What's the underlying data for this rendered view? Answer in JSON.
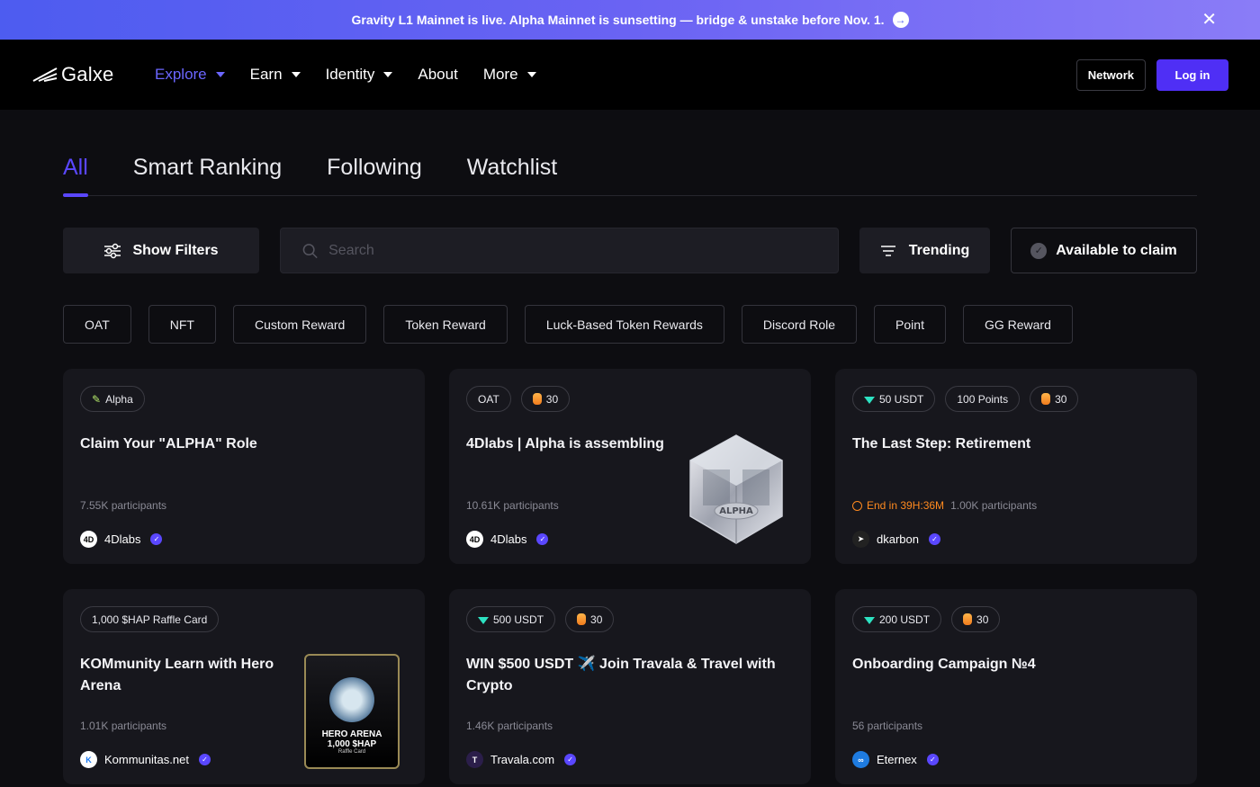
{
  "banner": {
    "text": "Gravity L1 Mainnet is live. Alpha Mainnet is sunsetting — bridge & unstake before Nov. 1.",
    "arrow": "→",
    "close": "✕"
  },
  "nav": {
    "logo": "Galxe",
    "items": [
      {
        "label": "Explore",
        "dropdown": true,
        "active": true
      },
      {
        "label": "Earn",
        "dropdown": true
      },
      {
        "label": "Identity",
        "dropdown": true
      },
      {
        "label": "About",
        "dropdown": false
      },
      {
        "label": "More",
        "dropdown": true
      }
    ],
    "network_label": "Network",
    "login_label": "Log in"
  },
  "tabs": [
    "All",
    "Smart Ranking",
    "Following",
    "Watchlist"
  ],
  "filters": {
    "show_filters": "Show Filters",
    "search_placeholder": "Search",
    "sort": "Trending",
    "claim": "Available to claim"
  },
  "chips": [
    "OAT",
    "NFT",
    "Custom Reward",
    "Token Reward",
    "Luck-Based Token Rewards",
    "Discord Role",
    "Point",
    "GG Reward"
  ],
  "cards": [
    {
      "badges": [
        {
          "icon": "pencil",
          "label": "Alpha"
        }
      ],
      "title": "Claim Your \"ALPHA\" Role",
      "participants": "7.55K participants",
      "owner": "4Dlabs",
      "owner_logo": "4D"
    },
    {
      "badges": [
        {
          "icon": "",
          "label": "OAT"
        },
        {
          "icon": "coin",
          "label": "30"
        }
      ],
      "title": "4Dlabs | Alpha is assembling",
      "participants": "10.61K participants",
      "owner": "4Dlabs",
      "owner_logo": "4D",
      "art": "ALPHA"
    },
    {
      "badges": [
        {
          "icon": "gem",
          "label": "50 USDT"
        },
        {
          "icon": "",
          "label": "100 Points"
        },
        {
          "icon": "coin",
          "label": "30"
        }
      ],
      "title": "The Last Step: Retirement",
      "end": "End in 39H:36M",
      "participants": "1.00K participants",
      "owner": "dkarbon",
      "owner_logo": "➤"
    },
    {
      "badges": [
        {
          "icon": "",
          "label": "1,000 $HAP Raffle Card"
        }
      ],
      "title": "KOMmunity Learn with Hero Arena",
      "participants": "1.01K participants",
      "owner": "Kommunitas.net",
      "owner_logo": "K",
      "art_lines": [
        "HERO ARENA",
        "1,000 $HAP",
        "Raffle Card"
      ]
    },
    {
      "badges": [
        {
          "icon": "gem",
          "label": "500 USDT"
        },
        {
          "icon": "coin",
          "label": "30"
        }
      ],
      "title": "WIN $500 USDT ✈️ Join Travala & Travel with Crypto",
      "participants": "1.46K participants",
      "owner": "Travala.com",
      "owner_logo": "T"
    },
    {
      "badges": [
        {
          "icon": "gem",
          "label": "200 USDT"
        },
        {
          "icon": "coin",
          "label": "30"
        }
      ],
      "title": "Onboarding Campaign №4",
      "participants": "56 participants",
      "owner": "Eternex",
      "owner_logo": "∞"
    }
  ],
  "colors": {
    "accent": "#5a47ff",
    "login": "#4f2ff5",
    "warning": "#ff8a1f",
    "bg": "#0d0d11",
    "card": "#17171d"
  }
}
